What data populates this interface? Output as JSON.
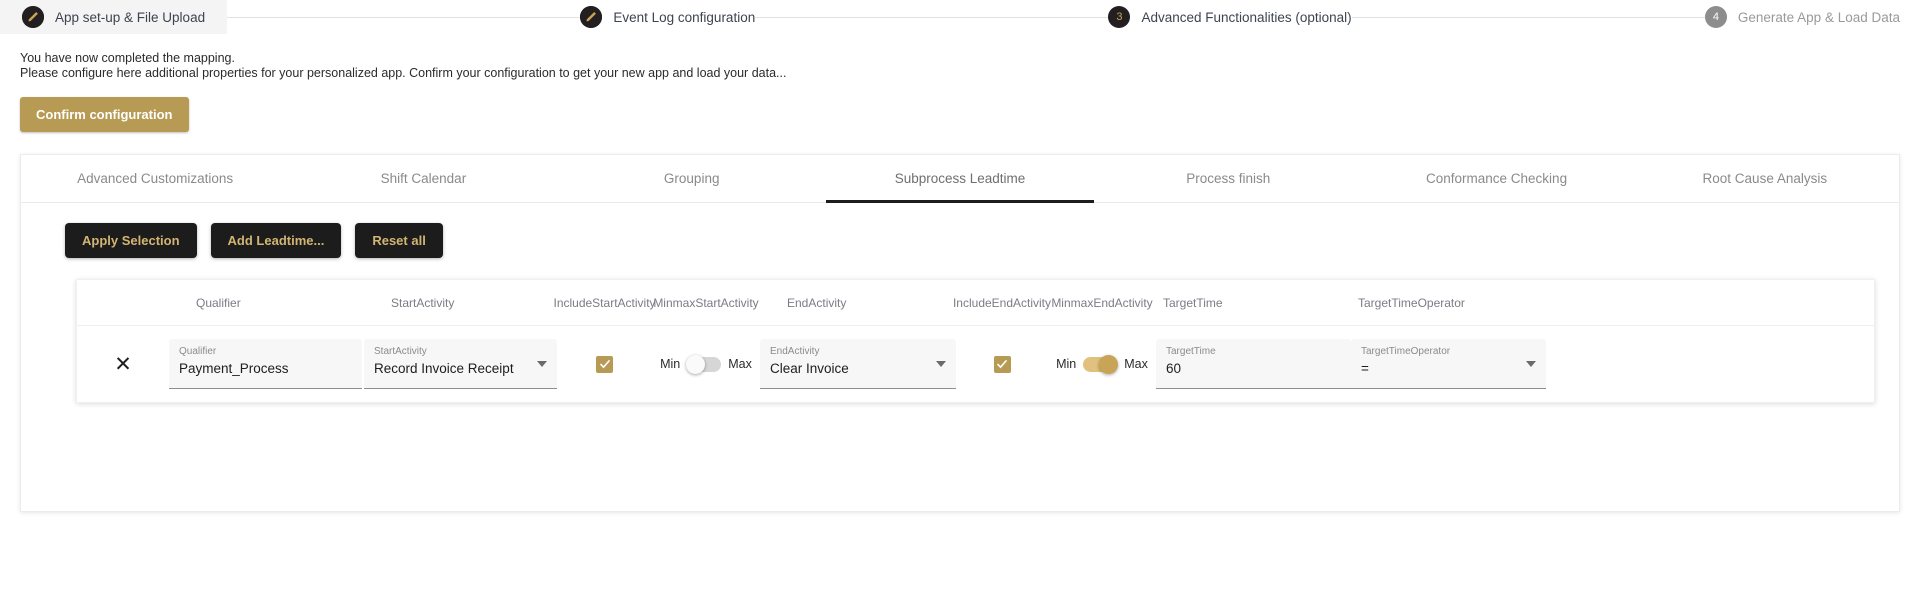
{
  "stepper": {
    "steps": [
      {
        "label": "App set-up & File Upload",
        "marker": "pencil",
        "state": "done"
      },
      {
        "label": "Event Log configuration",
        "marker": "pencil",
        "state": "done"
      },
      {
        "label": "Advanced Functionalities (optional)",
        "marker": "3",
        "state": "active"
      },
      {
        "label": "Generate App & Load Data",
        "marker": "4",
        "state": "inactive"
      }
    ]
  },
  "intro": {
    "line1": "You have now completed the mapping.",
    "line2": "Please configure here additional properties for your personalized app. Confirm your configuration to get your new app and load your data...",
    "confirm_label": "Confirm configuration"
  },
  "tabs": [
    {
      "label": "Advanced Customizations",
      "active": false
    },
    {
      "label": "Shift Calendar",
      "active": false
    },
    {
      "label": "Grouping",
      "active": false
    },
    {
      "label": "Subprocess Leadtime",
      "active": true
    },
    {
      "label": "Process finish",
      "active": false
    },
    {
      "label": "Conformance Checking",
      "active": false
    },
    {
      "label": "Root Cause Analysis",
      "active": false
    }
  ],
  "actions": {
    "apply_label": "Apply Selection",
    "add_label": "Add Leadtime...",
    "reset_label": "Reset all"
  },
  "table": {
    "headers": {
      "qualifier": "Qualifier",
      "start_activity": "StartActivity",
      "include_start_activity": "IncludeStartActivity",
      "minmax_start_activity": "MinmaxStartActivity",
      "end_activity": "EndActivity",
      "include_end_activity": "IncludeEndActivity",
      "minmax_end_activity": "MinmaxEndActivity",
      "target_time": "TargetTime",
      "target_time_operator": "TargetTimeOperator"
    },
    "rows": [
      {
        "remove_glyph": "✕",
        "qualifier": {
          "label": "Qualifier",
          "value": "Payment_Process"
        },
        "start_activity": {
          "label": "StartActivity",
          "value": "Record Invoice Receipt"
        },
        "include_start_activity": {
          "checked": true,
          "check_glyph": "✓"
        },
        "minmax_start_activity": {
          "min_label": "Min",
          "max_label": "Max",
          "state": "off"
        },
        "end_activity": {
          "label": "EndActivity",
          "value": "Clear Invoice"
        },
        "include_end_activity": {
          "checked": true,
          "check_glyph": "✓"
        },
        "minmax_end_activity": {
          "min_label": "Min",
          "max_label": "Max",
          "state": "on"
        },
        "target_time": {
          "label": "TargetTime",
          "value": "60"
        },
        "target_time_operator": {
          "label": "TargetTimeOperator",
          "value": "="
        }
      }
    ]
  },
  "colors": {
    "gold": "#b79b54",
    "dark": "#1c1c1c",
    "gold_text": "#d2b573",
    "toggle_on": "#c8a456"
  }
}
